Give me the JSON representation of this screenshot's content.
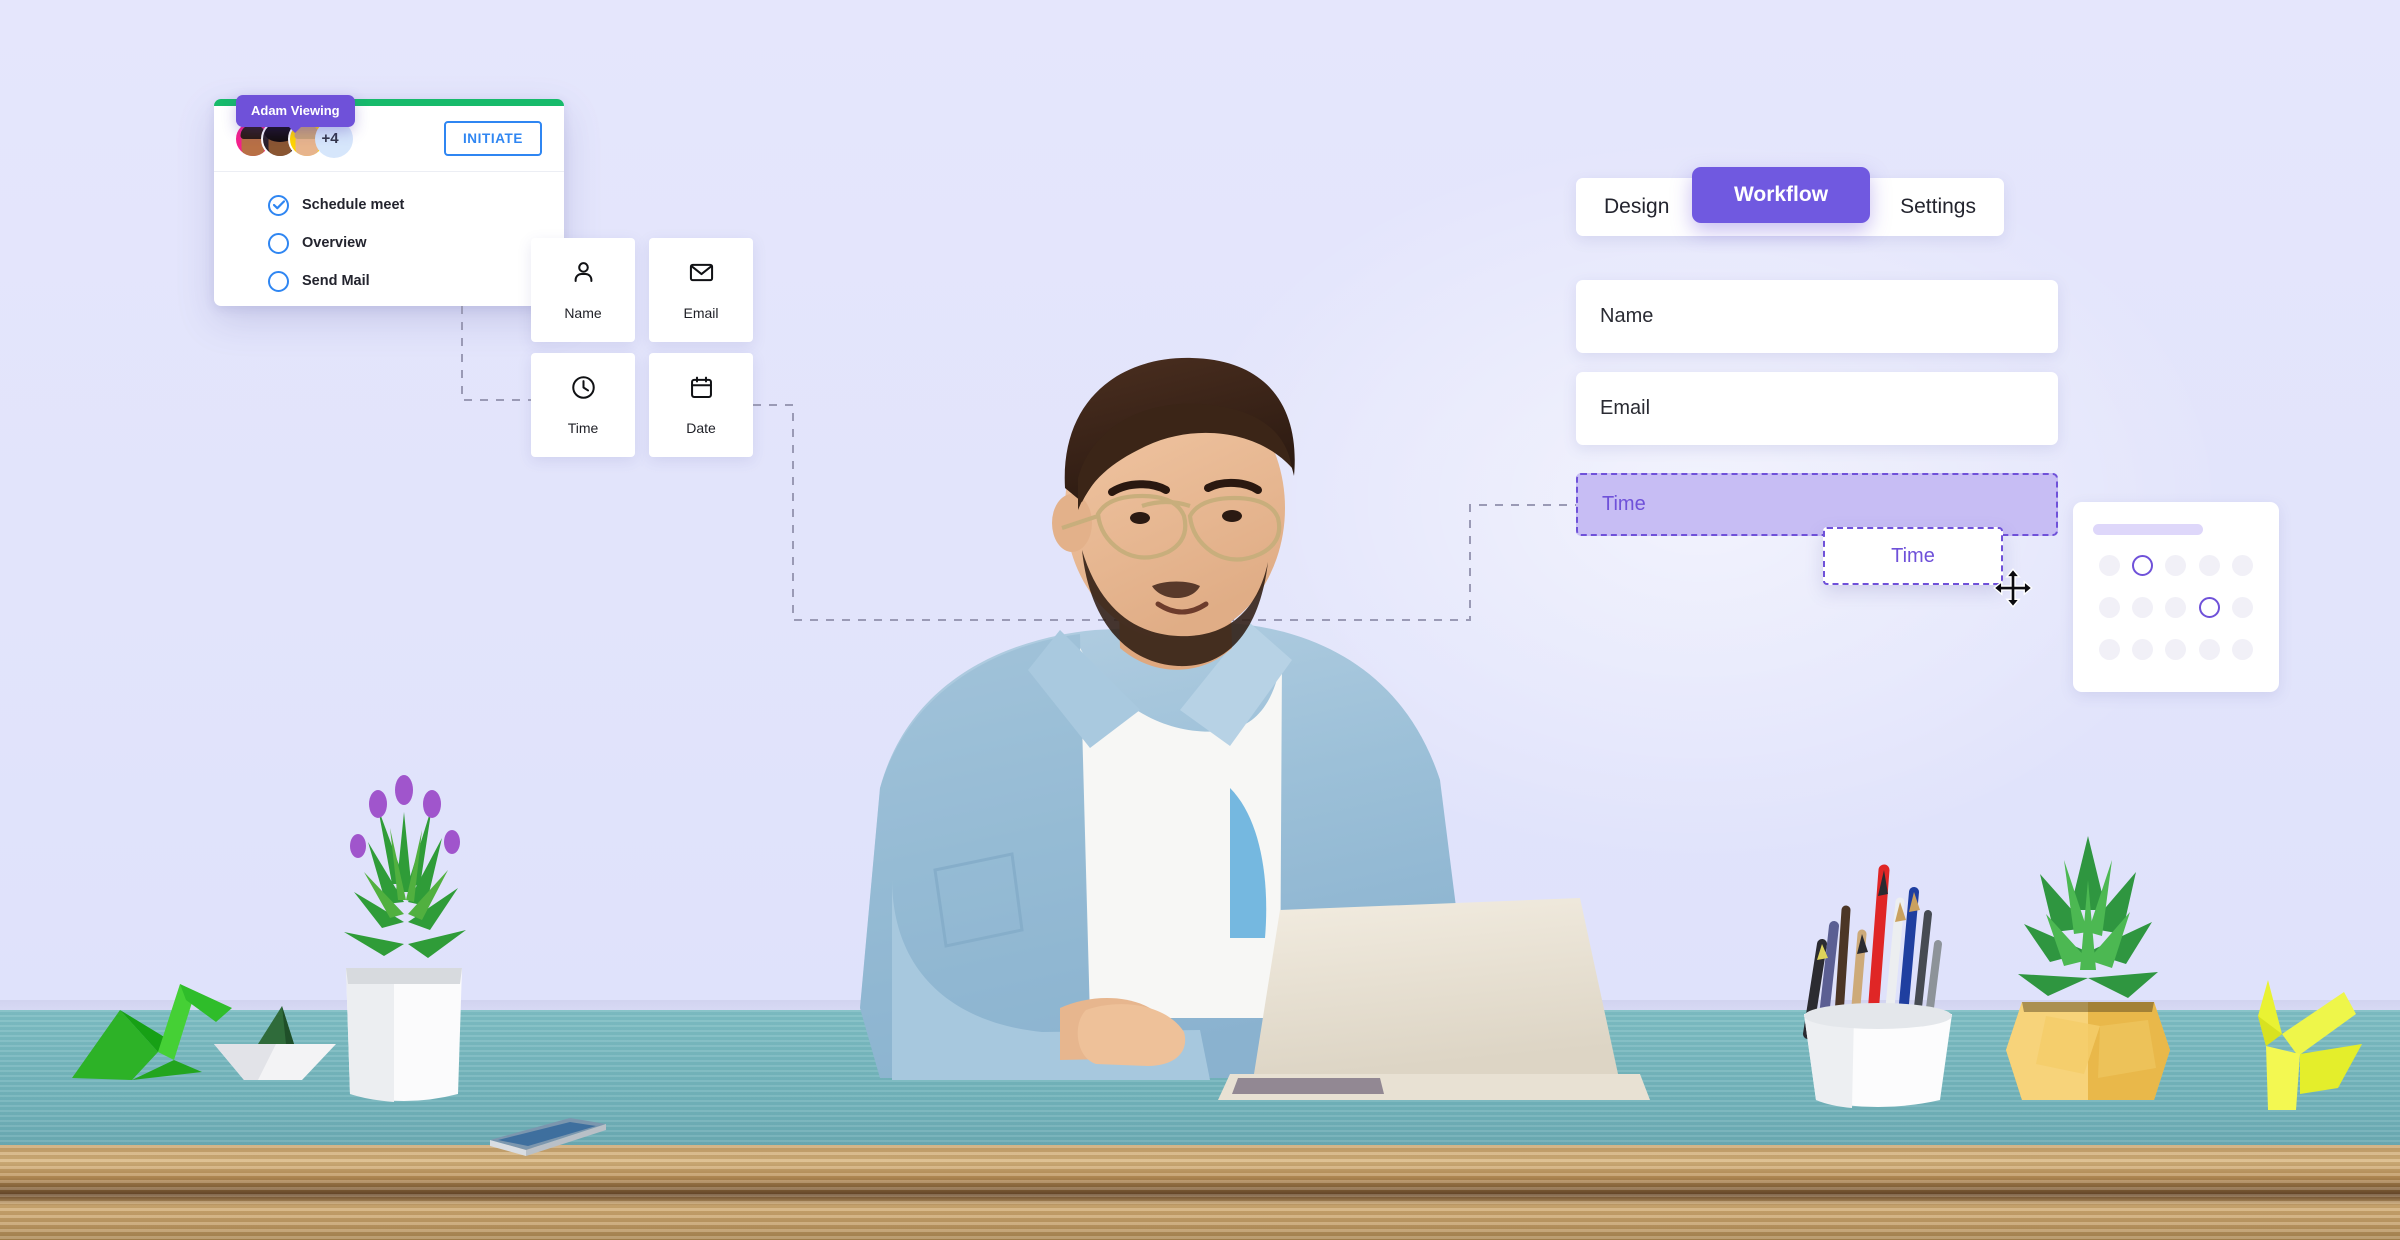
{
  "scene": {
    "background_color": "#e3e5fc",
    "desk_surface_color": "#74b5bc",
    "desk_edge_color": "#c9a36c",
    "accent_purple": "#6f51d9",
    "accent_blue": "#2f86f2",
    "accent_green": "#17ba6b"
  },
  "task_card": {
    "viewing_badge": "Adam Viewing",
    "avatar_overflow": "+4",
    "initiate_label": "INITIATE",
    "items": [
      {
        "label": "Schedule meet",
        "checked": true
      },
      {
        "label": "Overview",
        "checked": false
      },
      {
        "label": "Send Mail",
        "checked": false
      }
    ]
  },
  "field_tiles": [
    {
      "label": "Name",
      "icon": "person-icon"
    },
    {
      "label": "Email",
      "icon": "envelope-icon"
    },
    {
      "label": "Time",
      "icon": "clock-icon"
    },
    {
      "label": "Date",
      "icon": "calendar-icon"
    }
  ],
  "tabs": {
    "items": [
      {
        "label": "Design",
        "active": false
      },
      {
        "label": "Workflow",
        "active": true
      },
      {
        "label": "Settings",
        "active": false
      }
    ]
  },
  "form": {
    "fields": [
      {
        "label": "Name",
        "type": "text"
      },
      {
        "label": "Email",
        "type": "text"
      }
    ],
    "dropzone_label": "Time",
    "drag_chip_label": "Time",
    "cursor": "move-cursor"
  },
  "calendar_widget": {
    "selected_cells": [
      1,
      8
    ],
    "rows": 3,
    "cols": 5
  },
  "desk_props": [
    {
      "name": "origami-crane-green"
    },
    {
      "name": "paper-boat"
    },
    {
      "name": "white-planter-lavender-plant"
    },
    {
      "name": "smartphone"
    },
    {
      "name": "pencil-cup"
    },
    {
      "name": "yellow-geometric-planter"
    },
    {
      "name": "origami-crane-yellow"
    }
  ],
  "person": {
    "description": "man-at-laptop"
  }
}
